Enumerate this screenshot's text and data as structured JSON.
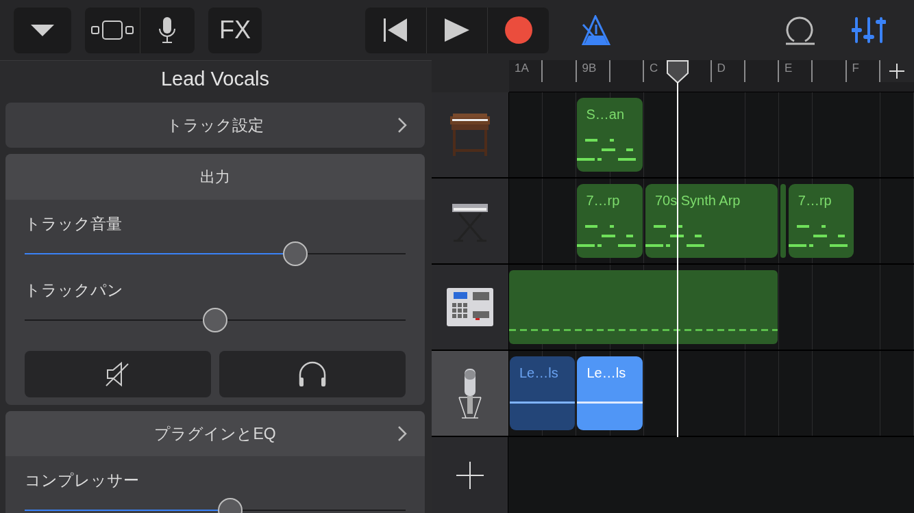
{
  "toolbar": {
    "fx_label": "FX",
    "metronome": {
      "on": true
    },
    "mixer": {
      "selected": true
    }
  },
  "track_panel": {
    "title": "Lead Vocals",
    "settings_row": "トラック設定",
    "output": {
      "header": "出力",
      "volume": {
        "label": "トラック音量",
        "level": 0.71
      },
      "pan": {
        "label": "トラックパン",
        "level": 0.5
      },
      "mute": {
        "on": false
      },
      "solo": {
        "on": false
      }
    },
    "plugins_row": "プラグインとEQ",
    "compressor": {
      "label": "コンプレッサー",
      "level": 0.54
    }
  },
  "ruler": {
    "markers": [
      "1A",
      "9B",
      "C",
      "D",
      "E",
      "F"
    ]
  },
  "tracks": [
    {
      "kind": "organ",
      "selected": false,
      "regions": [
        {
          "kind": "midi",
          "name": "S…an",
          "selected": false
        }
      ]
    },
    {
      "kind": "keyboard",
      "selected": false,
      "regions": [
        {
          "kind": "midi",
          "name": "7…rp",
          "selected": false
        },
        {
          "kind": "midi",
          "name": "70s Synth Arp",
          "selected": false
        },
        {
          "kind": "midi",
          "selected": false
        },
        {
          "kind": "midi",
          "name": "7…rp",
          "selected": false
        }
      ]
    },
    {
      "kind": "drum-machine",
      "selected": false,
      "regions": [
        {
          "kind": "drums",
          "selected": false
        }
      ]
    },
    {
      "kind": "microphone",
      "selected": true,
      "regions": [
        {
          "kind": "audio",
          "name": "Le…ls",
          "selected": false
        },
        {
          "kind": "audio",
          "name": "Le…ls",
          "selected": true
        }
      ]
    }
  ]
}
